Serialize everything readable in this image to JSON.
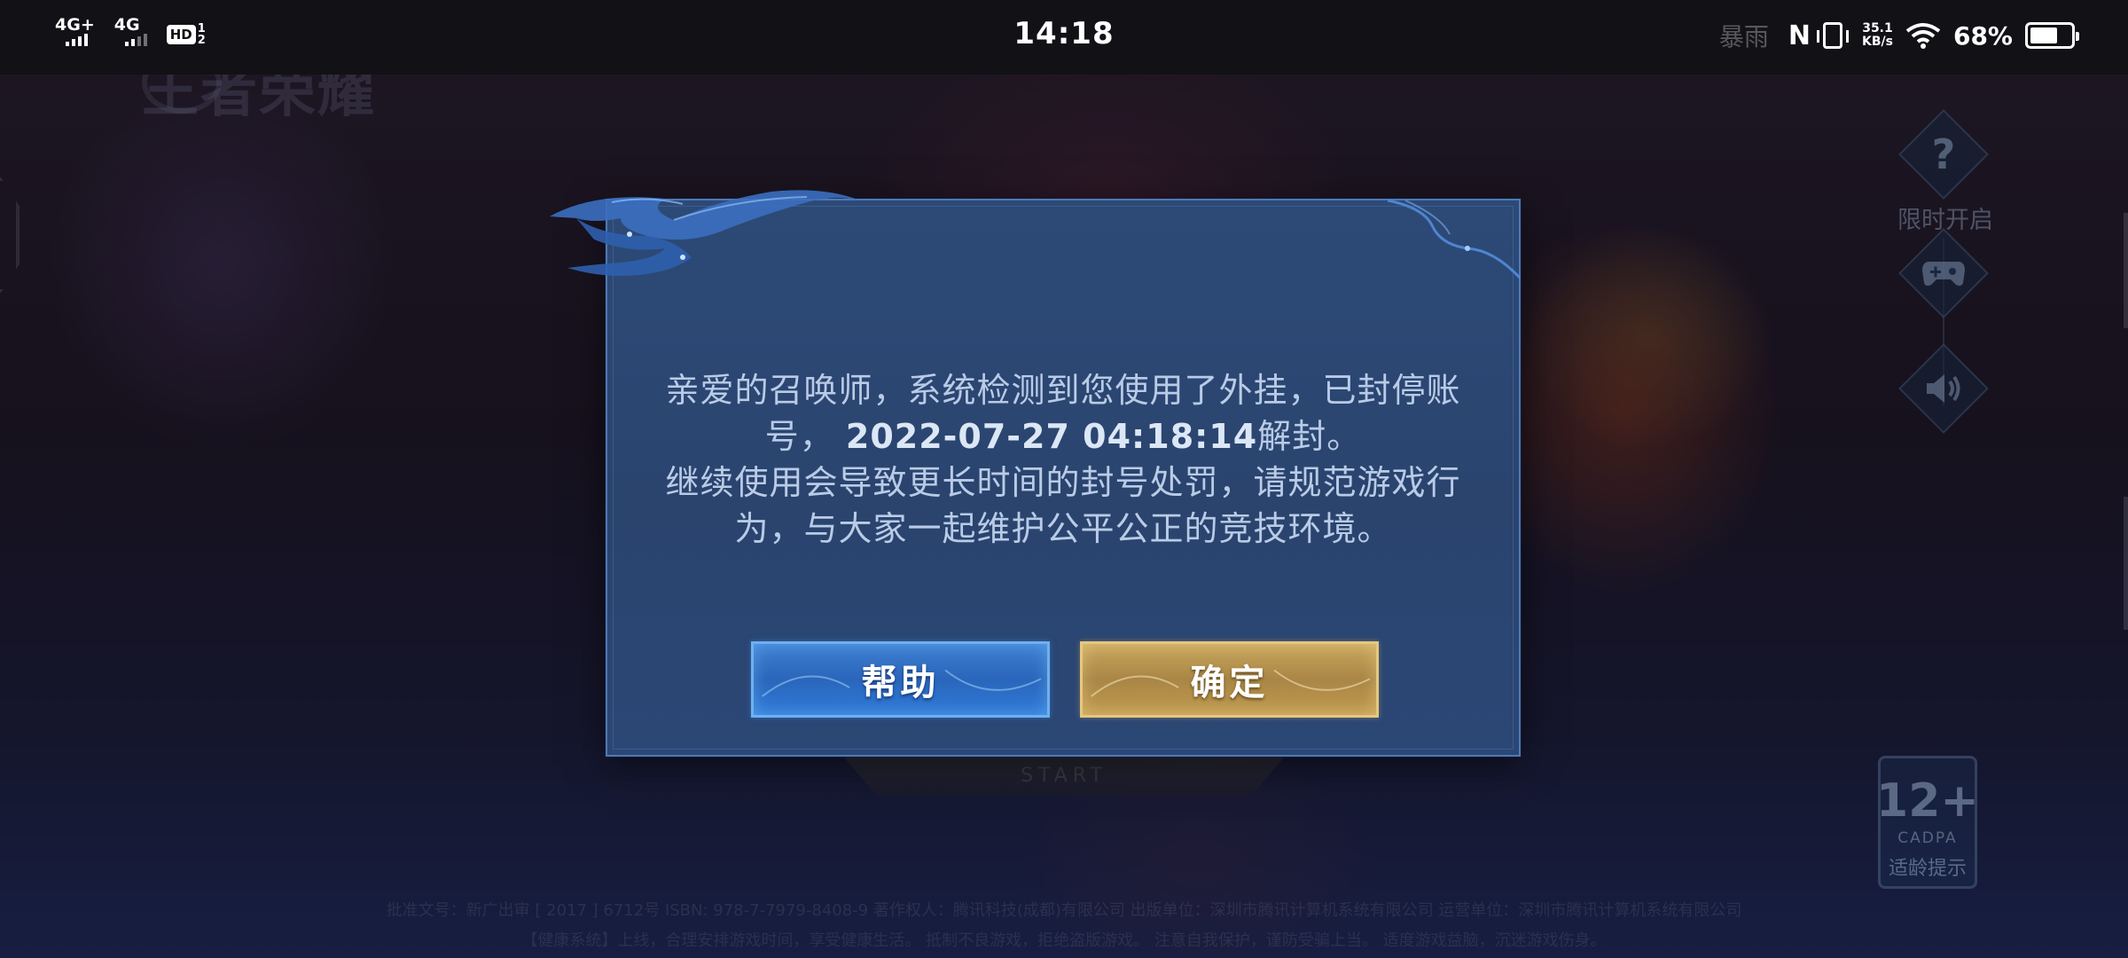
{
  "status_bar": {
    "signal1_label": "4G+",
    "signal2_label": "4G",
    "hd_label": "HD",
    "hd_sim1": "1",
    "hd_sim2": "2",
    "time": "14:18",
    "ghost_text": "暴雨",
    "net_speed_value": "35.1",
    "net_speed_unit": "KB/s",
    "battery_percent": "68%",
    "battery_level": 0.68
  },
  "background": {
    "logo_text": "王者荣耀",
    "start_text": "START",
    "legal_line1": "批准文号：新广出审 [ 2017 ] 6712号  ISBN: 978-7-7979-8408-9  著作权人：腾讯科技(成都)有限公司  出版单位：深圳市腾讯计算机系统有限公司  运营单位：深圳市腾讯计算机系统有限公司",
    "legal_line2": "【健康系统】上线，合理安排游戏时间，享受健康生活。  抵制不良游戏，拒绝盗版游戏。  注意自我保护，谨防受骗上当。  适度游戏益脑，沉迷游戏伤身。"
  },
  "side_panel": {
    "help_icon": "question-icon",
    "limited_label": "限时开启",
    "gamepad_icon": "gamepad-icon",
    "sound_icon": "speaker-icon"
  },
  "age_rating": {
    "age": "12+",
    "org": "CADPA",
    "tip": "适龄提示"
  },
  "dialog": {
    "line1": "亲爱的召唤师，系统检测到您使用了外挂，已封停账",
    "line2_prefix": "号，",
    "line2_date": "2022-07-27 04:18:14",
    "line2_suffix": "解封。",
    "line3": "继续使用会导致更长时间的封号处罚，请规范游戏行",
    "line4": "为，与大家一起维护公平公正的竞技环境。",
    "help_button": "帮助",
    "ok_button": "确定"
  }
}
